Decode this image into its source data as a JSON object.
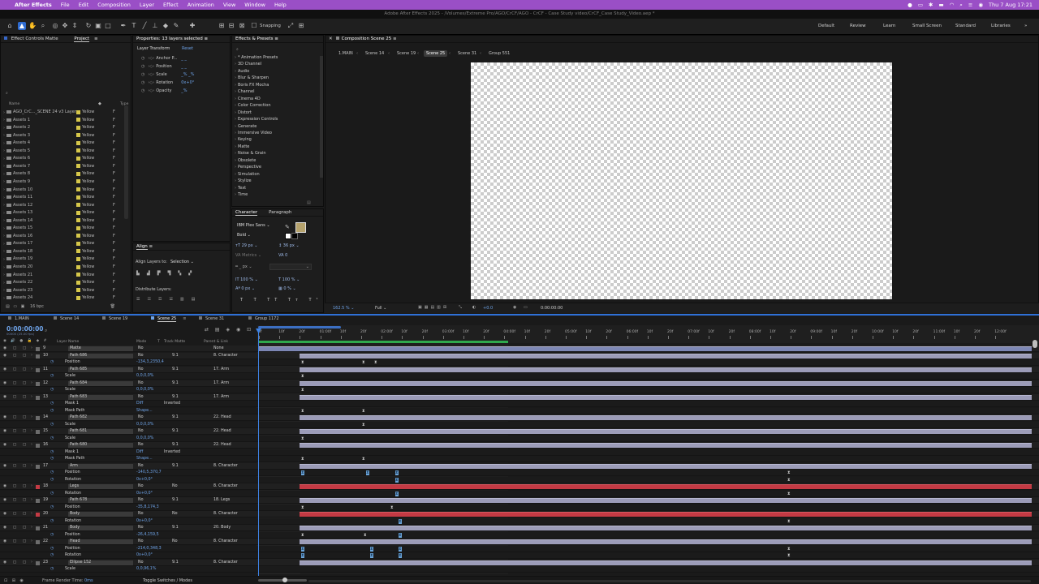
{
  "menubar": {
    "apple": "",
    "app": "After Effects",
    "items": [
      "File",
      "Edit",
      "Composition",
      "Layer",
      "Effect",
      "Animation",
      "View",
      "Window",
      "Help"
    ],
    "clock": "Thu 7 Aug  17:21"
  },
  "window_title": "Adobe After Effects 2025 - /Volumes/Extreme Pro/AGO/CrCF/AGO - CrCF - Case Study video/CrCF_Case Study_Video.aep *",
  "toolbar": {
    "snapping": "Snapping",
    "workspaces": [
      "Default",
      "Review",
      "Learn",
      "Small Screen",
      "Standard",
      "Libraries"
    ]
  },
  "project": {
    "tabs": [
      "Effect Controls Matte",
      "Project"
    ],
    "col_name": "Name",
    "col_type": "Type",
    "items": [
      {
        "name": "AGO_CrC..._SCENE 24 v3 Layers",
        "label": "Yellow",
        "type": "F"
      },
      {
        "name": "Assets 1",
        "label": "Yellow",
        "type": "F"
      },
      {
        "name": "Assets 2",
        "label": "Yellow",
        "type": "F"
      },
      {
        "name": "Assets 3",
        "label": "Yellow",
        "type": "F"
      },
      {
        "name": "Assets 4",
        "label": "Yellow",
        "type": "F"
      },
      {
        "name": "Assets 5",
        "label": "Yellow",
        "type": "F"
      },
      {
        "name": "Assets 6",
        "label": "Yellow",
        "type": "F"
      },
      {
        "name": "Assets 7",
        "label": "Yellow",
        "type": "F"
      },
      {
        "name": "Assets 8",
        "label": "Yellow",
        "type": "F"
      },
      {
        "name": "Assets 9",
        "label": "Yellow",
        "type": "F"
      },
      {
        "name": "Assets 10",
        "label": "Yellow",
        "type": "F"
      },
      {
        "name": "Assets 11",
        "label": "Yellow",
        "type": "F"
      },
      {
        "name": "Assets 12",
        "label": "Yellow",
        "type": "F"
      },
      {
        "name": "Assets 13",
        "label": "Yellow",
        "type": "F"
      },
      {
        "name": "Assets 14",
        "label": "Yellow",
        "type": "F"
      },
      {
        "name": "Assets 15",
        "label": "Yellow",
        "type": "F"
      },
      {
        "name": "Assets 16",
        "label": "Yellow",
        "type": "F"
      },
      {
        "name": "Assets 17",
        "label": "Yellow",
        "type": "F"
      },
      {
        "name": "Assets 18",
        "label": "Yellow",
        "type": "F"
      },
      {
        "name": "Assets 19",
        "label": "Yellow",
        "type": "F"
      },
      {
        "name": "Assets 20",
        "label": "Yellow",
        "type": "F"
      },
      {
        "name": "Assets 21",
        "label": "Yellow",
        "type": "F"
      },
      {
        "name": "Assets 22",
        "label": "Yellow",
        "type": "F"
      },
      {
        "name": "Assets 23",
        "label": "Yellow",
        "type": "F"
      },
      {
        "name": "Assets 24",
        "label": "Yellow",
        "type": "F"
      }
    ],
    "bpc": "16 bpc"
  },
  "properties": {
    "title": "Properties: 13 layers selected",
    "section": "Layer Transform",
    "reset": "Reset",
    "props": [
      {
        "name": "Anchor P...",
        "value": "_ _"
      },
      {
        "name": "Position",
        "value": "_ _"
      },
      {
        "name": "Scale",
        "value": "_% _%"
      },
      {
        "name": "Rotation",
        "value": "0x+0°"
      },
      {
        "name": "Opacity",
        "value": "_%"
      }
    ]
  },
  "align": {
    "title": "Align",
    "align_to_label": "Align Layers to:",
    "align_to": "Selection",
    "distribute": "Distribute Layers:"
  },
  "effects": {
    "title": "Effects & Presets",
    "items": [
      "* Animation Presets",
      "3D Channel",
      "Audio",
      "Blur & Sharpen",
      "Boris FX Mocha",
      "Channel",
      "Cinema 4D",
      "Color Correction",
      "Distort",
      "Expression Controls",
      "Generate",
      "Immersive Video",
      "Keying",
      "Matte",
      "Noise & Grain",
      "Obsolete",
      "Perspective",
      "Simulation",
      "Stylize",
      "Text",
      "Time"
    ]
  },
  "character": {
    "tabs": [
      "Character",
      "Paragraph"
    ],
    "font": "IBM Plex Sans",
    "style": "Bold",
    "size": "29 px",
    "leading": "36 px",
    "kerning": "Metrics",
    "tracking": "0",
    "indent": "_ px",
    "vscale": "100 %",
    "hscale": "100 %",
    "baseline": "0 px",
    "tsume": "0 %"
  },
  "composition": {
    "panel_title": "Composition Scene 25",
    "crumbs": [
      "1.MAIN",
      "Scene 14",
      "Scene 19",
      "Scene 25",
      "Scene 31",
      "Group 551"
    ],
    "active_crumb": "Scene 25",
    "zoom": "162.5 %",
    "quality": "Full",
    "exposure": "+0.0",
    "timecode": "0:00:00:00"
  },
  "timeline": {
    "tabs": [
      "1.MAIN",
      "Scene 14",
      "Scene 19",
      "Scene 25",
      "Scene 31",
      "Group 1172"
    ],
    "active_tab": "Scene 25",
    "timecode": "0:00:00:00",
    "fps": "00000 (25.00 fps)",
    "col_layer_name": "Layer Name",
    "col_mode": "Mode",
    "col_t": "T",
    "col_trkmat": "Track Matte",
    "col_parent": "Parent & Link",
    "ruler": [
      "0f",
      "10f",
      "20f",
      "01:00f",
      "10f",
      "20f",
      "02:00f",
      "10f",
      "20f",
      "03:00f",
      "10f",
      "20f",
      "04:00f",
      "10f",
      "20f",
      "05:00f",
      "10f",
      "20f",
      "06:00f",
      "10f",
      "20f",
      "07:00f",
      "10f",
      "20f",
      "08:00f",
      "10f",
      "20f",
      "09:00f",
      "10f",
      "20f",
      "10:00f",
      "10f",
      "20f",
      "11:00f",
      "10f",
      "20f",
      "12:00f"
    ],
    "rows": [
      {
        "num": "9",
        "name": "Matte",
        "mode": "No",
        "matte": "",
        "parent": "None"
      },
      {
        "num": "10",
        "name": "Path 686",
        "mode": "No",
        "matte": "9.1",
        "parent": "8. Character"
      },
      {
        "name": "Position",
        "value": "-134,3,2350,4"
      },
      {
        "num": "11",
        "name": "Path 685",
        "mode": "No",
        "matte": "9.1",
        "parent": "17. Arm"
      },
      {
        "name": "Scale",
        "value": "0,0,0,0%"
      },
      {
        "num": "12",
        "name": "Path 684",
        "mode": "No",
        "matte": "9.1",
        "parent": "17. Arm"
      },
      {
        "name": "Scale",
        "value": "0,0,0,0%"
      },
      {
        "num": "13",
        "name": "Path 683",
        "mode": "No",
        "matte": "9.1",
        "parent": "17. Arm"
      },
      {
        "name": "Mask 1",
        "value": "Diff",
        "extra": "Inverted"
      },
      {
        "name": "Mask Path",
        "value": "Shape..."
      },
      {
        "num": "14",
        "name": "Path 682",
        "mode": "No",
        "matte": "9.1",
        "parent": "22. Head"
      },
      {
        "name": "Scale",
        "value": "0,0,0,0%"
      },
      {
        "num": "15",
        "name": "Path 681",
        "mode": "No",
        "matte": "9.1",
        "parent": "22. Head"
      },
      {
        "name": "Scale",
        "value": "0,0,0,0%"
      },
      {
        "num": "16",
        "name": "Path 680",
        "mode": "No",
        "matte": "9.1",
        "parent": "22. Head"
      },
      {
        "name": "Mask 1",
        "value": "Diff",
        "extra": "Inverted"
      },
      {
        "name": "Mask Path",
        "value": "Shape..."
      },
      {
        "num": "17",
        "name": "Arm",
        "mode": "No",
        "matte": "9.1",
        "parent": "8. Character"
      },
      {
        "name": "Position",
        "value": "-140,5,370,7"
      },
      {
        "name": "Rotation",
        "value": "0x+0,0°"
      },
      {
        "num": "18",
        "name": "Legs",
        "mode": "No",
        "matte": "No",
        "parent": "8. Character"
      },
      {
        "name": "Rotation",
        "value": "0x+0,0°"
      },
      {
        "num": "19",
        "name": "Path 678",
        "mode": "No",
        "matte": "9.1",
        "parent": "18. Legs"
      },
      {
        "name": "Position",
        "value": "-35,8,174,3"
      },
      {
        "num": "20",
        "name": "Body",
        "mode": "No",
        "matte": "No",
        "parent": "8. Character"
      },
      {
        "name": "Rotation",
        "value": "0x+0,0°"
      },
      {
        "num": "21",
        "name": "Body",
        "mode": "No",
        "matte": "9.1",
        "parent": "20. Body"
      },
      {
        "name": "Position",
        "value": "-26,4,159,5"
      },
      {
        "num": "22",
        "name": "Head",
        "mode": "No",
        "matte": "No",
        "parent": "8. Character"
      },
      {
        "name": "Position",
        "value": "-214,0,348,3"
      },
      {
        "name": "Rotation",
        "value": "0x+0,0°"
      },
      {
        "num": "23",
        "name": "Ellipse 152",
        "mode": "No",
        "matte": "9.1",
        "parent": "8. Character"
      },
      {
        "name": "Scale",
        "value": "0,0,96,1%"
      }
    ],
    "footer_left": "Frame Render Time:",
    "footer_render": "0ms",
    "footer_toggle": "Toggle Switches / Modes"
  },
  "colors": {
    "menubar": "#9a4fc6",
    "accent": "#2e6bd0",
    "bar": "#9c9cb8",
    "bar_red": "#c43a44",
    "label_yellow": "#d6c74a"
  }
}
